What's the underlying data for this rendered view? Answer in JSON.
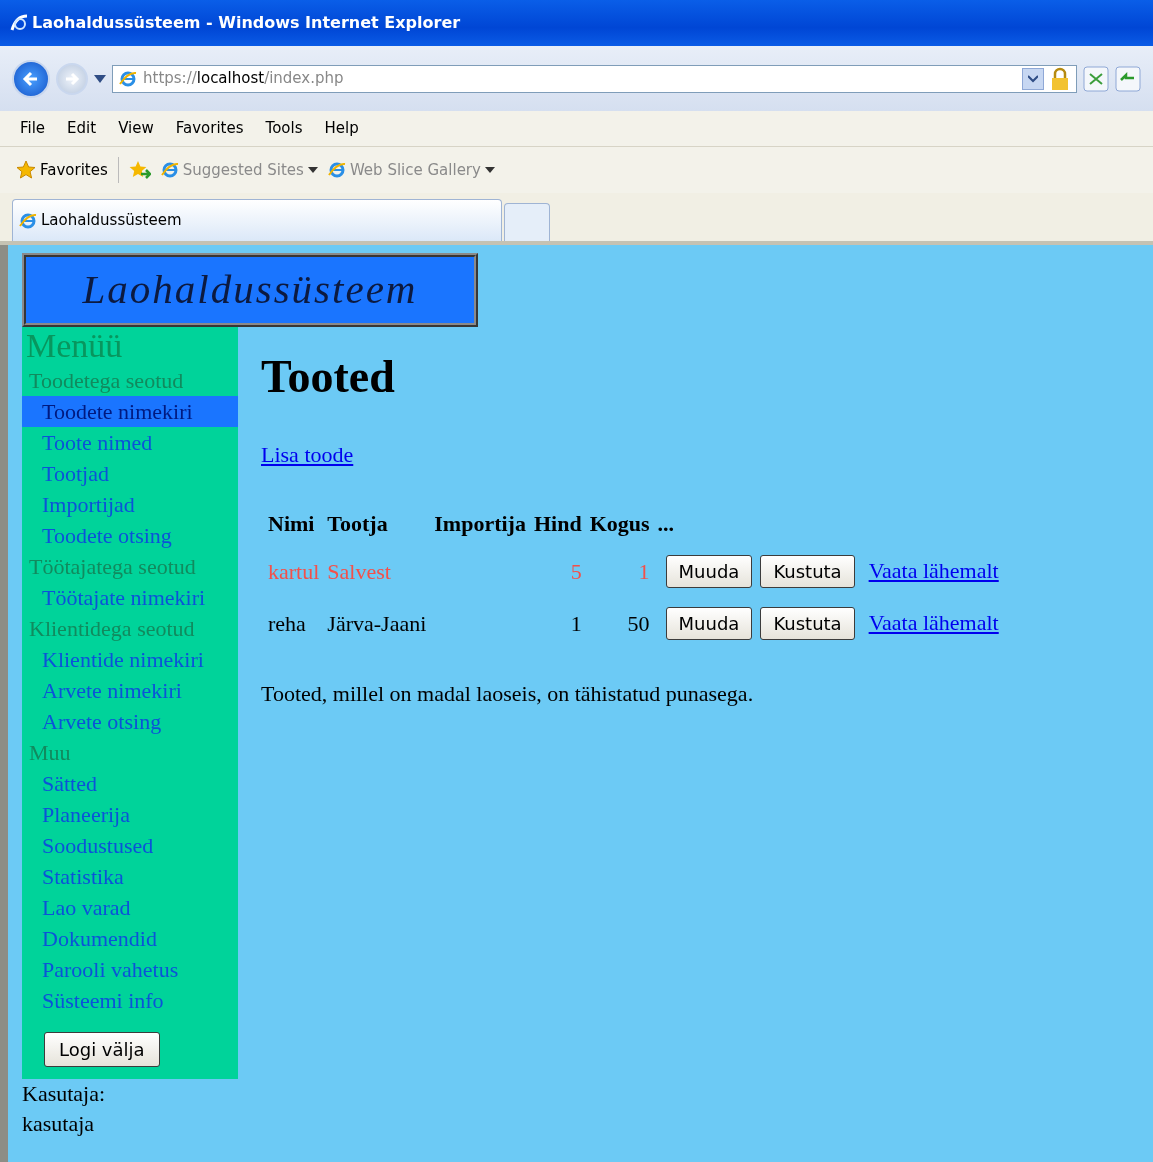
{
  "window": {
    "title": "Laohaldussüsteem - Windows Internet Explorer"
  },
  "address": {
    "scheme": "https://",
    "host": "localhost",
    "path": "/index.php"
  },
  "menu_bar": [
    "File",
    "Edit",
    "View",
    "Favorites",
    "Tools",
    "Help"
  ],
  "favorites_bar": {
    "label": "Favorites",
    "links": [
      "Suggested Sites",
      "Web Slice Gallery"
    ]
  },
  "tabs": [
    {
      "label": "Laohaldussüsteem",
      "selected": true
    }
  ],
  "page": {
    "logo": "Laohaldussüsteem",
    "sidebar": {
      "title": "Menüü",
      "groups": [
        {
          "label": "Toodetega seotud",
          "children": [
            {
              "label": "Toodete nimekiri",
              "selected": true
            },
            {
              "label": "Toote nimed",
              "selected": false
            },
            {
              "label": "Tootjad",
              "selected": false
            },
            {
              "label": "Importijad",
              "selected": false
            },
            {
              "label": "Toodete otsing",
              "selected": false
            }
          ]
        },
        {
          "label": "Töötajatega seotud",
          "children": [
            {
              "label": "Töötajate nimekiri",
              "selected": false
            }
          ]
        },
        {
          "label": "Klientidega seotud",
          "children": [
            {
              "label": "Klientide nimekiri",
              "selected": false
            },
            {
              "label": "Arvete nimekiri",
              "selected": false
            },
            {
              "label": "Arvete otsing",
              "selected": false
            }
          ]
        },
        {
          "label": "Muu",
          "children": [
            {
              "label": "Sätted",
              "selected": false
            },
            {
              "label": "Planeerija",
              "selected": false
            },
            {
              "label": "Soodustused",
              "selected": false
            },
            {
              "label": "Statistika",
              "selected": false
            },
            {
              "label": "Lao varad",
              "selected": false
            },
            {
              "label": "Dokumendid",
              "selected": false
            },
            {
              "label": "Parooli vahetus",
              "selected": false
            },
            {
              "label": "Süsteemi info",
              "selected": false
            }
          ]
        }
      ],
      "logout": "Logi välja"
    },
    "user_label": "Kasutaja:",
    "user_name": "kasutaja",
    "heading": "Tooted",
    "add_link": "Lisa toode",
    "table": {
      "columns": [
        "Nimi",
        "Tootja",
        "Importija",
        "Hind",
        "Kogus",
        "..."
      ],
      "rows": [
        {
          "cells": [
            "kartul",
            "Salvest",
            "",
            "5",
            "1"
          ],
          "low_stock": true,
          "buttons": [
            "Muuda",
            "Kustuta"
          ],
          "link": "Vaata lähemalt"
        },
        {
          "cells": [
            "reha",
            "Järva-Jaani",
            "",
            "1",
            "50"
          ],
          "low_stock": false,
          "buttons": [
            "Muuda",
            "Kustuta"
          ],
          "link": "Vaata lähemalt"
        }
      ]
    },
    "note": "Tooted, millel on madal laoseis, on tähistatud punasega."
  }
}
